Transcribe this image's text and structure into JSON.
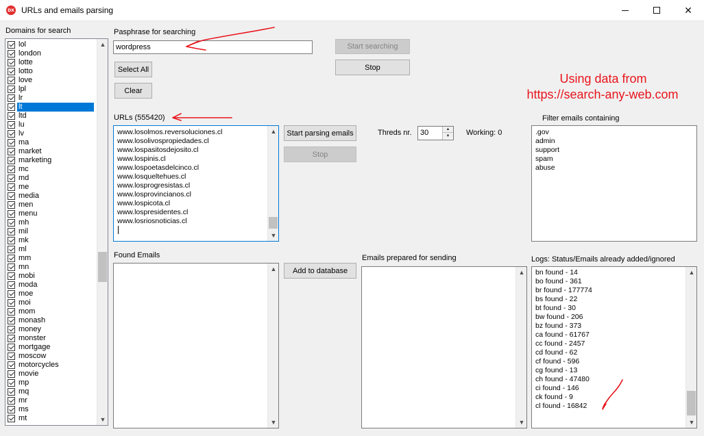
{
  "window": {
    "app_icon": "DX",
    "title": "URLs and emails parsing",
    "controls": {
      "minimize": "minimize-icon",
      "maximize": "maximize-icon",
      "close": "close-icon",
      "close_glyph": "✕"
    }
  },
  "domains": {
    "label": "Domains for search",
    "items": [
      "lol",
      "london",
      "lotte",
      "lotto",
      "love",
      "lpl",
      "lr",
      "lt",
      "ltd",
      "lu",
      "lv",
      "ma",
      "market",
      "marketing",
      "mc",
      "md",
      "me",
      "media",
      "men",
      "menu",
      "mh",
      "mil",
      "mk",
      "ml",
      "mm",
      "mn",
      "mobi",
      "moda",
      "moe",
      "moi",
      "mom",
      "monash",
      "money",
      "monster",
      "mortgage",
      "moscow",
      "motorcycles",
      "movie",
      "mp",
      "mq",
      "mr",
      "ms",
      "mt"
    ],
    "selected": "lt"
  },
  "passphrase": {
    "label": "Pasphrase for searching",
    "value": "wordpress"
  },
  "buttons": {
    "select_all": "Select All",
    "clear": "Clear",
    "start_searching": "Start searching",
    "stop_search": "Stop",
    "start_parsing": "Start parsing emails",
    "stop_parsing": "Stop",
    "add_to_database": "Add to database"
  },
  "annotation": {
    "line1": "Using data from",
    "line2": "https://search-any-web.com",
    "color": "#e8141c"
  },
  "urls": {
    "label": "URLs (555420)",
    "items": [
      "www.losolmos.reversoluciones.cl",
      "www.losolivospropiedades.cl",
      "www.lospasitosdejosito.cl",
      "www.lospinis.cl",
      "www.lospoetasdelcinco.cl",
      "www.losqueltehues.cl",
      "www.losprogresistas.cl",
      "www.losprovincianos.cl",
      "www.lospicota.cl",
      "www.lospresidentes.cl",
      "www.losriosnoticias.cl"
    ]
  },
  "threads": {
    "label": "Threds nr.",
    "value": "30",
    "working_label": "Working: 0"
  },
  "filter": {
    "label": "Filter emails containing",
    "items": [
      ".gov",
      "admin",
      "support",
      "spam",
      "abuse"
    ]
  },
  "found_emails": {
    "label": "Found Emails"
  },
  "prepared": {
    "label": "Emails prepared for sending"
  },
  "logs": {
    "label": "Logs: Status/Emails already added/ignored",
    "items": [
      "bn found - 14",
      "bo found - 361",
      "br found - 177774",
      "bs found - 22",
      "bt found - 30",
      "bw found - 206",
      "bz found - 373",
      "ca found - 61767",
      "cc found - 2457",
      "cd found - 62",
      "cf found - 596",
      "cg found - 13",
      "ch found - 47480",
      "ci found - 146",
      "ck found - 9",
      "cl found - 16842"
    ]
  }
}
